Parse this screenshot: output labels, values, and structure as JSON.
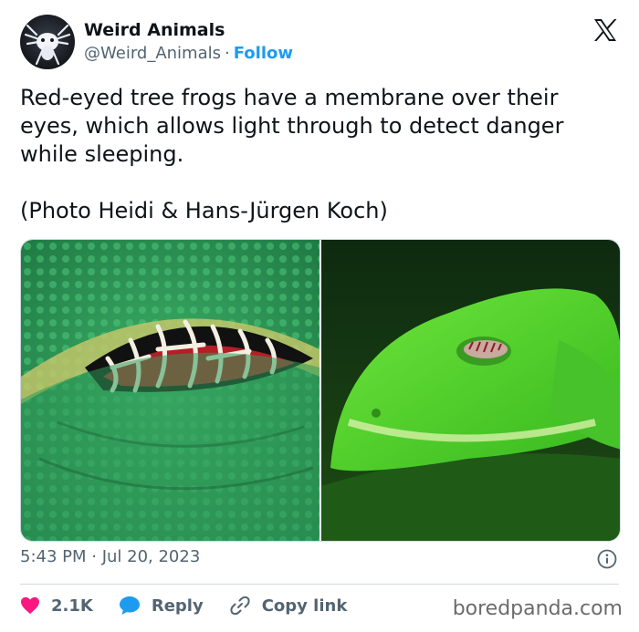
{
  "author": {
    "name": "Weird Animals",
    "handle": "@Weird_Animals",
    "separator": "·",
    "follow_label": "Follow"
  },
  "tweet": {
    "text": "Red-eyed tree frogs have a membrane over their eyes, which allows light through to detect danger while sleeping.",
    "credit": "(Photo Heidi & Hans-Jürgen Koch)",
    "timestamp": "5:43 PM · Jul 20, 2023"
  },
  "actions": {
    "likes": "2.1K",
    "reply_label": "Reply",
    "copy_link_label": "Copy link"
  },
  "watermark": "boredpanda.com",
  "colors": {
    "accent": "#1d9bf0",
    "like": "#f91880",
    "text": "#0f1419",
    "muted": "#536471"
  },
  "icons": {
    "platform": "x-logo-icon",
    "like": "heart-icon",
    "reply": "speech-bubble-icon",
    "copy_link": "link-icon",
    "info": "info-icon"
  }
}
